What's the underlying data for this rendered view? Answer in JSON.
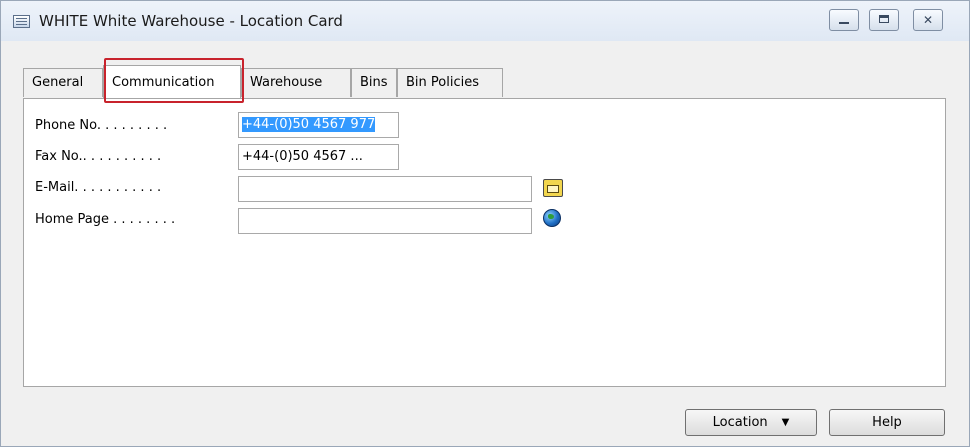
{
  "window": {
    "title": "WHITE White Warehouse - Location Card",
    "controls": {
      "minimize": "",
      "maximize": "",
      "close": "✕"
    }
  },
  "tabs": [
    {
      "label": "General",
      "active": false
    },
    {
      "label": "Communication",
      "active": true
    },
    {
      "label": "Warehouse",
      "active": false
    },
    {
      "label": "Bins",
      "active": false
    },
    {
      "label": "Bin Policies",
      "active": false
    }
  ],
  "fields": {
    "phone": {
      "label": "Phone No. . . . . . . . .",
      "value": "+44-(0)50 4567 977",
      "selected": true
    },
    "fax": {
      "label": "Fax No.. . . . . . . . . .",
      "value": "+44-(0)50 4567 ..."
    },
    "email": {
      "label": "E-Mail. . . . . . . . . . .",
      "value": "",
      "icon": "mail-icon"
    },
    "homepage": {
      "label": "Home Page . . . . . . . .",
      "value": "",
      "icon": "globe-icon"
    }
  },
  "buttons": {
    "location": {
      "label": "Location",
      "icon": "dropdown-arrow-icon"
    },
    "help": {
      "label": "Help"
    }
  },
  "colors": {
    "highlight_border": "#c8232c",
    "selection": "#3399ff"
  }
}
